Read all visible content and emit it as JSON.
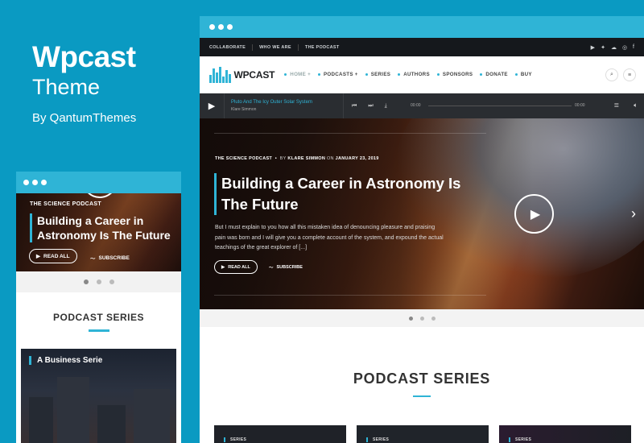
{
  "promo": {
    "title": "Wpcast",
    "subtitle": "Theme",
    "by": "By QantumThemes"
  },
  "colors": {
    "accent": "#2fb4d6",
    "background": "#0a9ac2",
    "dark": "#15181c"
  },
  "mobile": {
    "kicker": "THE SCIENCE PODCAST",
    "hero_title": "Building a Career in Astronomy Is The Future",
    "read_label": "READ ALL",
    "subscribe_label": "SUBSCRIBE",
    "series_title": "PODCAST SERIES",
    "card_title": "A Business Serie"
  },
  "desktop": {
    "topbar": {
      "links": [
        "COLLABORATE",
        "WHO WE ARE",
        "THE PODCAST"
      ],
      "social_icons": [
        "youtube-icon",
        "twitter-icon",
        "soundcloud-icon",
        "instagram-icon",
        "facebook-icon"
      ]
    },
    "logo_text": "WPCAST",
    "menu": [
      {
        "label": "HOME",
        "active": true,
        "plus": true
      },
      {
        "label": "PODCASTS",
        "active": false,
        "plus": true
      },
      {
        "label": "SERIES",
        "active": false,
        "plus": false
      },
      {
        "label": "AUTHORS",
        "active": false,
        "plus": false
      },
      {
        "label": "SPONSORS",
        "active": false,
        "plus": false
      },
      {
        "label": "DONATE",
        "active": false,
        "plus": false
      },
      {
        "label": "BUY",
        "active": false,
        "plus": false
      }
    ],
    "player": {
      "track_title": "Pluto And The Icy Outer Solar System",
      "track_author": "Klare Simmon",
      "time_current": "00:00",
      "time_total": "00:00"
    },
    "hero": {
      "kicker": "THE SCIENCE PODCAST",
      "kicker_by": "BY",
      "kicker_author": "KLARE SIMMON",
      "kicker_on": "ON",
      "kicker_date": "JANUARY 23, 2019",
      "title": "Building a Career in Astronomy Is The Future",
      "excerpt": "But I must explain to you how all this mistaken idea of denouncing pleasure and praising pain was born and I will give you a complete account of the system, and expound the actual teachings of the great explorer of [...]",
      "read_label": "READ ALL",
      "subscribe_label": "SUBSCRIBE"
    },
    "series_title": "PODCAST SERIES",
    "cards": [
      "SERIES",
      "SERIES",
      "SERIES"
    ]
  }
}
